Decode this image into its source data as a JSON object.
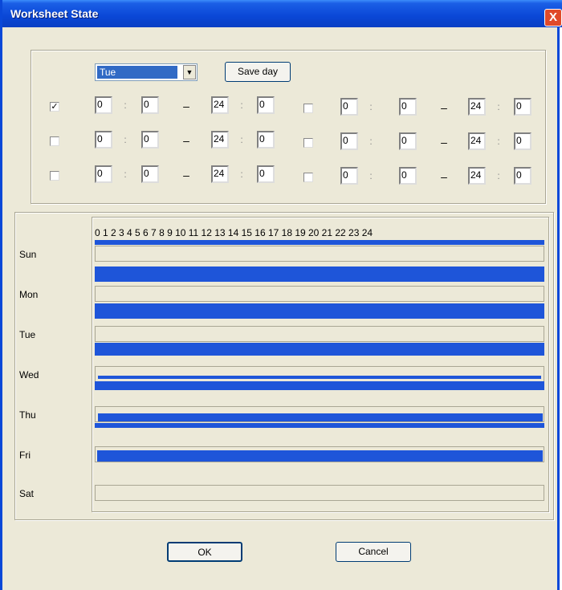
{
  "window": {
    "title": "Worksheet State",
    "close_label": "X"
  },
  "day_select": {
    "value": "Tue"
  },
  "save_day_label": "Save day",
  "periods": [
    {
      "enabled": true,
      "start_hour": "0",
      "start_min": "0",
      "end_hour": "24",
      "end_min": "0"
    },
    {
      "enabled": false,
      "start_hour": "0",
      "start_min": "0",
      "end_hour": "24",
      "end_min": "0"
    },
    {
      "enabled": false,
      "start_hour": "0",
      "start_min": "0",
      "end_hour": "24",
      "end_min": "0"
    },
    {
      "enabled": false,
      "start_hour": "0",
      "start_min": "0",
      "end_hour": "24",
      "end_min": "0"
    },
    {
      "enabled": false,
      "start_hour": "0",
      "start_min": "0",
      "end_hour": "24",
      "end_min": "0"
    },
    {
      "enabled": false,
      "start_hour": "0",
      "start_min": "0",
      "end_hour": "24",
      "end_min": "0"
    }
  ],
  "separators": {
    "colon": ":",
    "dash": "–"
  },
  "hours_scale": "0 1 2 3 4 5 6 7 8 9 10 11 12 13 14 15 16 17 18 19 20 21 22 23 24",
  "days": [
    "Sun",
    "Mon",
    "Tue",
    "Wed",
    "Thu",
    "Fri",
    "Sat"
  ],
  "buttons": {
    "ok": "OK",
    "cancel": "Cancel"
  },
  "colors": {
    "schedule_bar": "#1e55d9",
    "title_bar": "#0a47d6",
    "dialog_bg": "#ece9d8"
  }
}
